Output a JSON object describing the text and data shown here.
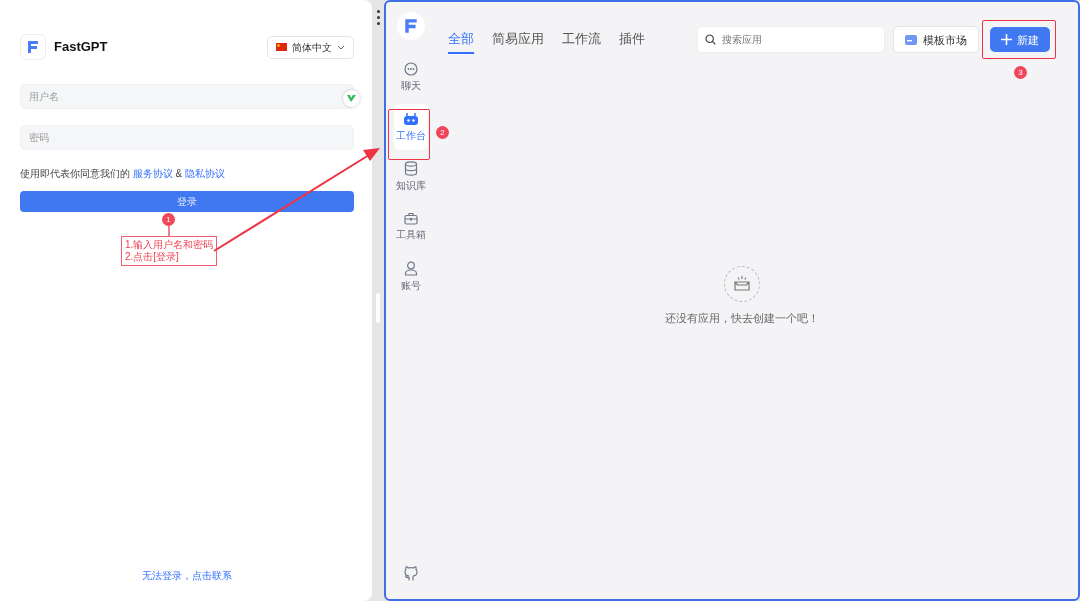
{
  "login": {
    "brand": "FastGPT",
    "language": "简体中文",
    "username": {
      "placeholder": "用户名"
    },
    "password": {
      "placeholder": "密码"
    },
    "agreement": {
      "text": "使用即代表你同意我们的",
      "links": [
        "服务协议",
        "隐私协议"
      ],
      "joiner": "&"
    },
    "login_button": "登录",
    "help_link": "无法登录，点击联系"
  },
  "app": {
    "tabs": [
      {
        "label": "全部",
        "selected": true
      },
      {
        "label": "简易应用",
        "selected": false
      },
      {
        "label": "工作流",
        "selected": false
      },
      {
        "label": "插件",
        "selected": false
      }
    ],
    "search": {
      "placeholder": "搜索应用"
    },
    "template_button": "模板市场",
    "create_button": "新建",
    "sidebar": {
      "items": [
        {
          "label": "聊天",
          "kind": "chat",
          "selected": false
        },
        {
          "label": "工作台",
          "kind": "robot",
          "selected": true
        },
        {
          "label": "知识库",
          "kind": "database",
          "selected": false
        },
        {
          "label": "工具箱",
          "kind": "toolbox",
          "selected": false
        },
        {
          "label": "账号",
          "kind": "account",
          "selected": false
        }
      ]
    },
    "empty_state": "还没有应用，快去创建一个吧！"
  },
  "annotations": {
    "markers": [
      "1",
      "2",
      "3"
    ],
    "callout": [
      "1.输入用户名和密码",
      "2.点击[登录]"
    ]
  }
}
